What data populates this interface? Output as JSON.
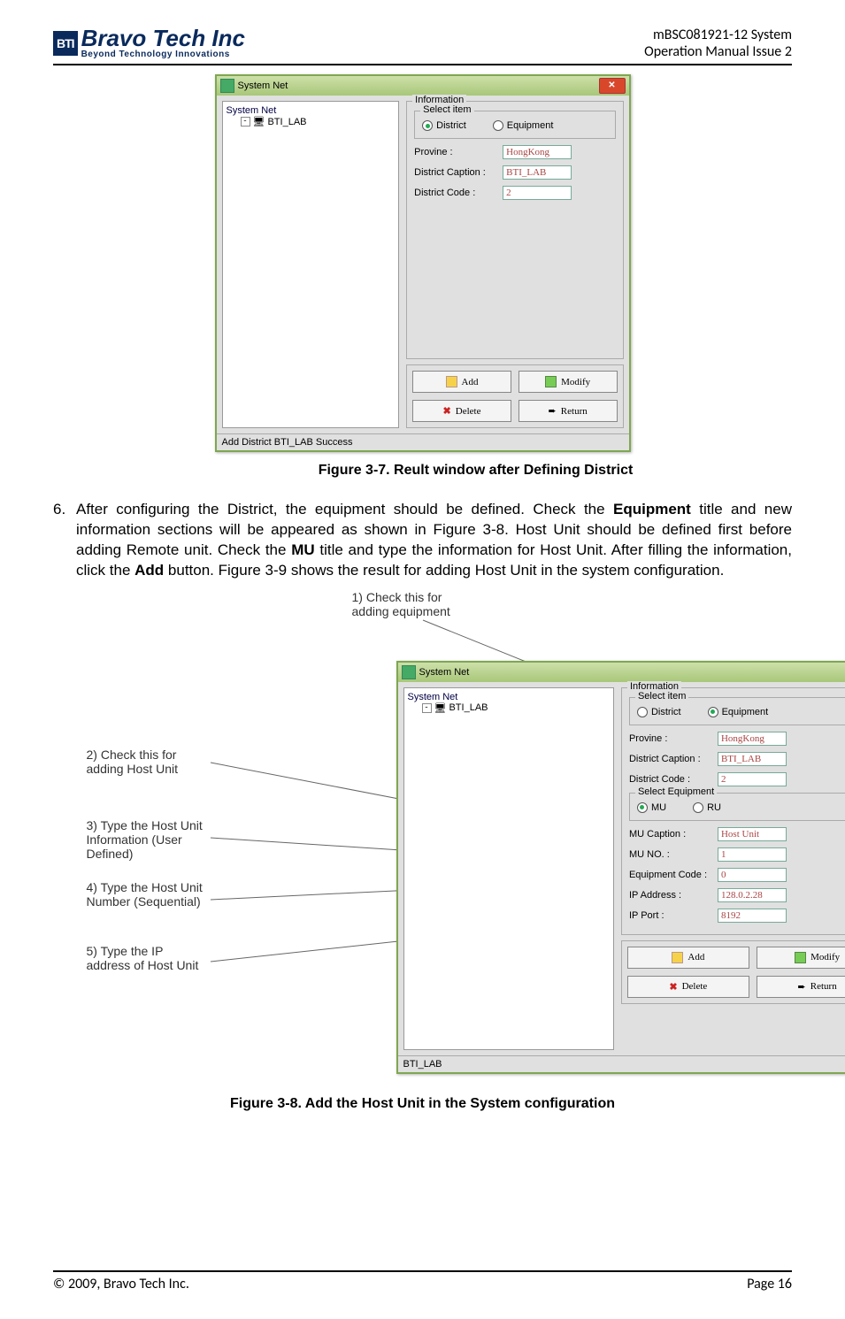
{
  "header": {
    "logo_tag": "BTI",
    "logo_main": "Bravo Tech Inc",
    "logo_sub": "Beyond Technology Innovations",
    "doc_line1": "mBSC081921-12 System",
    "doc_line2": "Operation Manual Issue 2"
  },
  "fig1": {
    "title": "System Net",
    "tree_root": "System Net",
    "tree_item": "BTI_LAB",
    "info_legend": "Information",
    "select_legend": "Select item",
    "radio_district": "District",
    "radio_equipment": "Equipment",
    "labels": {
      "provine": "Provine :",
      "district_caption": "District Caption :",
      "district_code": "District Code :"
    },
    "values": {
      "provine": "HongKong",
      "district_caption": "BTI_LAB",
      "district_code": "2"
    },
    "buttons": {
      "add": "Add",
      "modify": "Modify",
      "delete": "Delete",
      "return": "Return"
    },
    "status": "Add District BTI_LAB Success",
    "caption": "Figure 3-7. Reult window after Defining District"
  },
  "para": {
    "num": "6.",
    "t1": "After configuring the District, the equipment should be defined. Check the ",
    "b1": "Equipment",
    "t2": " title and new information sections will be appeared as shown in Figure 3-8. Host Unit should be defined first before adding Remote unit. Check the ",
    "b2": "MU",
    "t3": " title and type the information for Host Unit. After filling the information, click the ",
    "b3": "Add",
    "t4": " button. Figure 3-9 shows the result for adding Host Unit in the system configuration."
  },
  "annotations": {
    "a1": "1) Check this for adding equipment",
    "a2": "2) Check this for adding Host Unit",
    "a3": "3) Type the Host Unit Information (User Defined)",
    "a4": "4) Type the Host Unit Number (Sequential)",
    "a5": "5) Type the IP address of Host Unit"
  },
  "fig2": {
    "title": "System Net",
    "tree_root": "System Net",
    "tree_item": "BTI_LAB",
    "info_legend": "Information",
    "select_legend": "Select item",
    "radio_district": "District",
    "radio_equipment": "Equipment",
    "sel_eq_legend": "Select Equipment",
    "radio_mu": "MU",
    "radio_ru": "RU",
    "labels": {
      "provine": "Provine :",
      "district_caption": "District Caption :",
      "district_code": "District Code :",
      "mu_caption": "MU Caption :",
      "mu_no": "MU NO. :",
      "eq_code": "Equipment Code :",
      "ip_addr": "IP Address :",
      "ip_port": "IP Port :"
    },
    "values": {
      "provine": "HongKong",
      "district_caption": "BTI_LAB",
      "district_code": "2",
      "mu_caption": "Host Unit",
      "mu_no": "1",
      "eq_code": "0",
      "ip_addr": "128.0.2.28",
      "ip_port": "8192"
    },
    "buttons": {
      "add": "Add",
      "modify": "Modify",
      "delete": "Delete",
      "return": "Return"
    },
    "status": "BTI_LAB",
    "caption": "Figure 3-8. Add the Host Unit in the System configuration"
  },
  "footer": {
    "copyright": "© 2009, Bravo Tech Inc.",
    "page": "Page 16"
  }
}
